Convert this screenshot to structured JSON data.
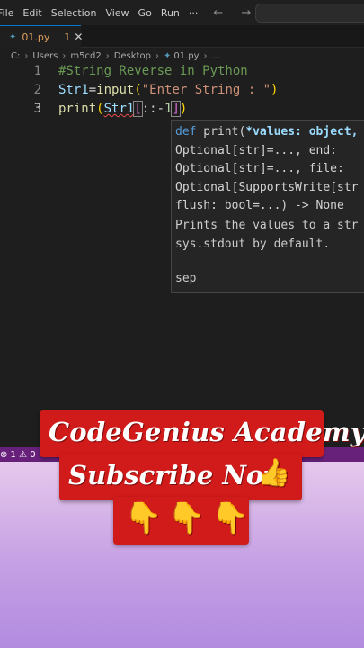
{
  "menu": {
    "items": [
      "File",
      "Edit",
      "Selection",
      "View",
      "Go",
      "Run",
      "···"
    ],
    "nav": "← →"
  },
  "tab": {
    "icon": "python-file-icon",
    "name": "01.py",
    "problems": "1",
    "close": "✕"
  },
  "breadcrumb": {
    "parts": [
      "C:",
      "Users",
      "m5cd2",
      "Desktop",
      "01.py",
      "..."
    ]
  },
  "editor": {
    "line_numbers": [
      "1",
      "2",
      "3"
    ],
    "line1": "#String Reverse in Python",
    "line2_var": "Str1",
    "line2_eq": "=",
    "line2_fn": "input",
    "line2_open": "(",
    "line2_str": "\"Enter String : \"",
    "line2_close": ")",
    "line3_fn": "print",
    "line3_open": "(",
    "line3_var": "Str1",
    "line3_bopen": "[",
    "line3_slice": "::-",
    "line3_num": "1",
    "line3_bclose": "]",
    "line3_close": ")"
  },
  "hover": {
    "sig_def": "def",
    "sig_fn": " print(",
    "sig_param": "*values: object,",
    "sig_l2": "Optional[str]=..., end:",
    "sig_l3": "Optional[str]=..., file:",
    "sig_l4": "Optional[SupportsWrite[str",
    "sig_l5": "flush: bool=...) -> None",
    "doc_l1": "Prints the values to a str",
    "doc_l2": "sys.stdout by default.",
    "doc_l3": "sep"
  },
  "status": {
    "text": "⊗ 1 ⚠ 0"
  },
  "overlay": {
    "title": "CodeGenius Academy",
    "subscribe": "Subscribe Now",
    "thumb": "👍",
    "hands": "👇👇👇"
  },
  "colors": {
    "status_bar": "#68217a",
    "banner": "#d11a1a",
    "accent": "#0078d4"
  }
}
